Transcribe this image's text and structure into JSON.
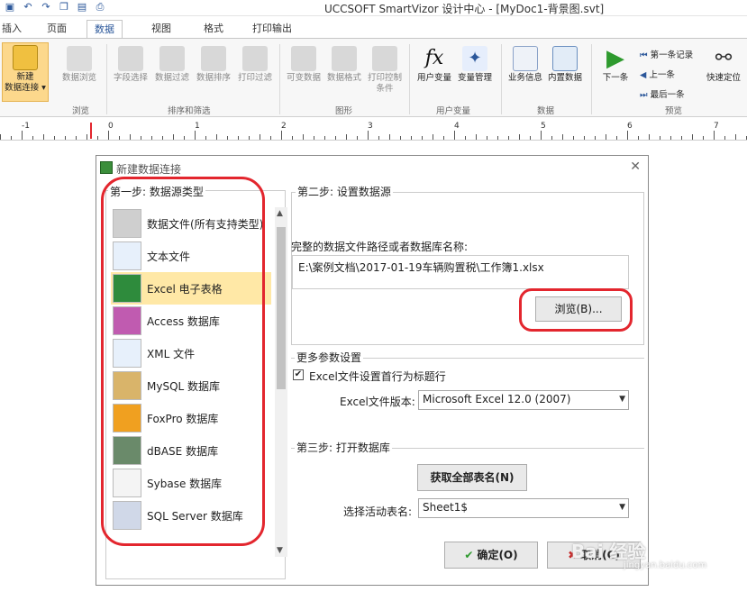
{
  "titlebar": {
    "app_title": "UCCSOFT SmartVizor 设计中心 - [MyDoc1-背景图.svt]"
  },
  "tabs": [
    {
      "label": "插入"
    },
    {
      "label": "页面"
    },
    {
      "label": "数据"
    },
    {
      "label": "视图"
    },
    {
      "label": "格式"
    },
    {
      "label": "打印输出"
    }
  ],
  "ribbon": {
    "new_conn_label": "新建\n数据连接",
    "buttons": {
      "browse": "数据浏览",
      "field_select": "字段选择",
      "data_filter": "数据过滤",
      "data_sort": "数据排序",
      "print_filter": "打印过滤",
      "variable_data": "可变数据",
      "data_format": "数据格式",
      "print_control": "打印控制条件",
      "user_var": "用户变量",
      "var_manage": "变量管理",
      "biz_info": "业务信息",
      "builtin_data": "内置数据",
      "next_one": "下一条",
      "first_record": "第一条记录",
      "prev_one": "上一条",
      "last_one": "最后一条",
      "quick_locate": "快速定位"
    },
    "groups": {
      "browse": "浏览",
      "sort_filter": "排序和筛选",
      "shape": "图形",
      "user_var": "用户变量",
      "data": "数据",
      "preview": "预览"
    }
  },
  "ruler": {
    "labels": [
      "-1",
      "0",
      "1",
      "2",
      "3",
      "4",
      "5",
      "6",
      "7"
    ]
  },
  "dialog": {
    "title": "新建数据连接",
    "step1_title": "第一步: 数据源类型",
    "step2_title": "第二步: 设置数据源",
    "path_label": "完整的数据文件路径或者数据库名称:",
    "path_value": "E:\\案例文档\\2017-01-19车辆购置税\\工作簿1.xlsx",
    "browse_button": "浏览(B)...",
    "more_title": "更多参数设置",
    "header_checkbox_label": "Excel文件设置首行为标题行",
    "version_label": "Excel文件版本:",
    "version_value": "Microsoft Excel 12.0 (2007)",
    "step3_title": "第三步: 打开数据库",
    "get_all_button": "获取全部表名(N)",
    "active_sheet_label": "选择活动表名:",
    "active_sheet_value": "Sheet1$",
    "ok_button": "确定(O)",
    "cancel_button": "取消(C)",
    "datasource_types": [
      {
        "label": "数据文件(所有支持类型)",
        "icon": "database-file-icon",
        "selected": false
      },
      {
        "label": "文本文件",
        "icon": "text-file-icon",
        "selected": false
      },
      {
        "label": "Excel 电子表格",
        "icon": "excel-icon",
        "selected": true
      },
      {
        "label": "Access 数据库",
        "icon": "access-key-icon",
        "selected": false
      },
      {
        "label": "XML 文件",
        "icon": "xml-file-icon",
        "selected": false
      },
      {
        "label": "MySQL 数据库",
        "icon": "mysql-icon",
        "selected": false
      },
      {
        "label": "FoxPro 数据库",
        "icon": "foxpro-icon",
        "selected": false
      },
      {
        "label": "dBASE 数据库",
        "icon": "dbase-icon",
        "selected": false
      },
      {
        "label": "Sybase 数据库",
        "icon": "sybase-icon",
        "selected": false
      },
      {
        "label": "SQL Server 数据库",
        "icon": "sql-server-icon",
        "selected": false
      }
    ]
  },
  "watermark": {
    "text": "Bai 经验",
    "url": "jingyan.baidu.com"
  },
  "colors": {
    "accent": "#2b579a",
    "annotation_red": "#e3262e",
    "selected_row": "#ffe8a6"
  }
}
